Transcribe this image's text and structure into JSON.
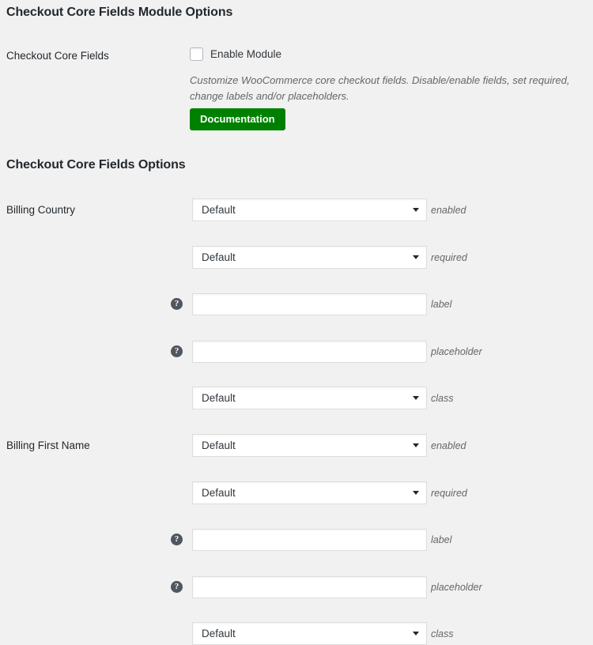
{
  "module": {
    "title": "Checkout Core Fields Module Options",
    "row_label": "Checkout Core Fields",
    "enable_checkbox_label": "Enable Module",
    "description": "Customize WooCommerce core checkout fields. Disable/enable fields, set required, change labels and/or placeholders.",
    "documentation_button": "Documentation",
    "accent_color": "#008000",
    "enabled": false
  },
  "options_section": {
    "title": "Checkout Core Fields Options",
    "default_value": "Default",
    "help_icon": "help-question-icon",
    "caret_icon": "chevron-down-icon",
    "fields": [
      {
        "label": "Billing Country",
        "rows": [
          {
            "type": "select",
            "value": "Default",
            "suffix": "enabled",
            "help": false
          },
          {
            "type": "select",
            "value": "Default",
            "suffix": "required",
            "help": false
          },
          {
            "type": "text",
            "value": "",
            "suffix": "label",
            "help": true
          },
          {
            "type": "text",
            "value": "",
            "suffix": "placeholder",
            "help": true
          },
          {
            "type": "select",
            "value": "Default",
            "suffix": "class",
            "help": false
          }
        ]
      },
      {
        "label": "Billing First Name",
        "rows": [
          {
            "type": "select",
            "value": "Default",
            "suffix": "enabled",
            "help": false
          },
          {
            "type": "select",
            "value": "Default",
            "suffix": "required",
            "help": false
          },
          {
            "type": "text",
            "value": "",
            "suffix": "label",
            "help": true
          },
          {
            "type": "text",
            "value": "",
            "suffix": "placeholder",
            "help": true
          },
          {
            "type": "select",
            "value": "Default",
            "suffix": "class",
            "help": false
          }
        ]
      }
    ]
  }
}
